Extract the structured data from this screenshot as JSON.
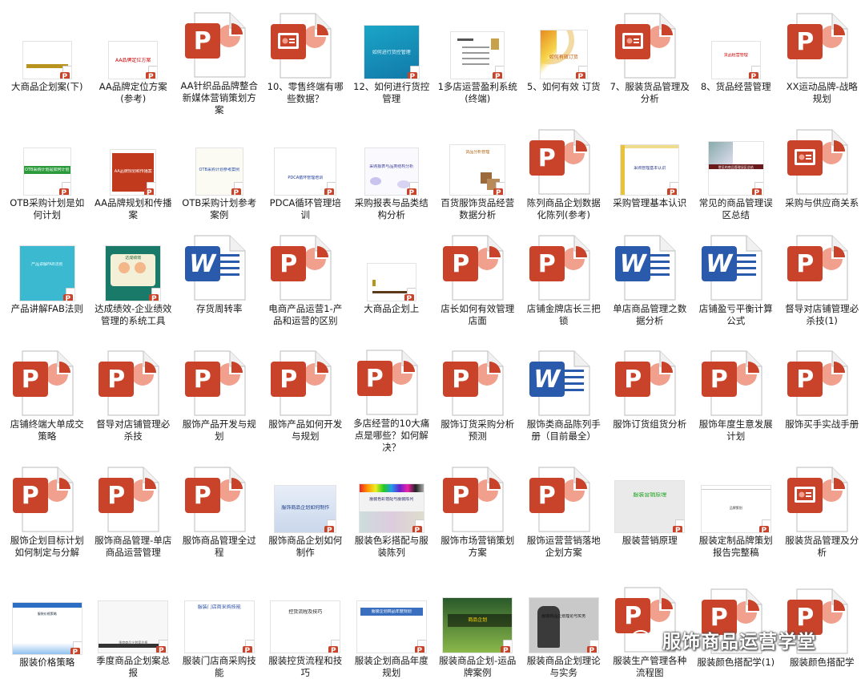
{
  "files": [
    {
      "label": "大商品企划案(下)",
      "kind": "slide",
      "style": "s_gold",
      "slide_text": ""
    },
    {
      "label": "AA品牌定位方案(参考)",
      "kind": "slide",
      "style": "s_redtitle",
      "slide_text": "AA品牌定位方案"
    },
    {
      "label": "AA针织品品牌整合新媒体营销策划方案",
      "kind": "ppt"
    },
    {
      "label": "10、零售终端有哪些数据？",
      "kind": "ppt_open"
    },
    {
      "label": "12、如何进行货控管理",
      "kind": "slide",
      "style": "s_teal",
      "slide_text": "如何进行货控管理"
    },
    {
      "label": "1多店运营盈利系统(终端)",
      "kind": "slide",
      "style": "s_list",
      "slide_text": ""
    },
    {
      "label": "5、如何有效 订货",
      "kind": "slide",
      "style": "s_swirl",
      "slide_text": "如何有效订货"
    },
    {
      "label": "7、服装货品管理及分析",
      "kind": "ppt_open"
    },
    {
      "label": "8、货品经营管理",
      "kind": "slide",
      "style": "s_redsmall",
      "slide_text": "货品经营管理"
    },
    {
      "label": "XX运动品牌-战略规划",
      "kind": "ppt"
    },
    {
      "label": "OTB采购计划是如何计划",
      "kind": "slide",
      "style": "s_greenbar",
      "slide_text": "OTB采购计划是如何计划"
    },
    {
      "label": "AA品牌规划和传播案",
      "kind": "slide",
      "style": "s_redblock",
      "slide_text": "AA品牌规划和传播案"
    },
    {
      "label": "OTB采购计划参考案例",
      "kind": "slide",
      "style": "s_bluetext",
      "slide_text": "OTB采购计划参考案例"
    },
    {
      "label": "PDCA循环管理培训",
      "kind": "slide",
      "style": "s_pdca",
      "slide_text": "PDCA循环管理培训"
    },
    {
      "label": "采购报表与品类结构分析",
      "kind": "slide",
      "style": "s_bubbles",
      "slide_text": "采购报表与品类结构分析"
    },
    {
      "label": "百货服饰货品经营数据分析",
      "kind": "slide",
      "style": "s_boxes",
      "slide_text": "货品分析管理"
    },
    {
      "label": "陈列商品企划数据化陈列(参考)",
      "kind": "ppt"
    },
    {
      "label": "采购管理基本认识",
      "kind": "slide",
      "style": "s_yellowleft",
      "slide_text": "采购管理基本认识"
    },
    {
      "label": "常见的商品管理误区总结",
      "kind": "slide",
      "style": "s_darkband",
      "slide_text": "常见的商品管理误区总结"
    },
    {
      "label": "采购与供应商关系",
      "kind": "ppt_open"
    },
    {
      "label": "产品讲解FAB法则",
      "kind": "slide",
      "style": "s_cyan",
      "slide_text": "产品讲解FAB法则"
    },
    {
      "label": "达成绩效-企业绩效管理的系统工具",
      "kind": "slide",
      "style": "s_cartoon",
      "slide_text": "达成绩效"
    },
    {
      "label": "存货周转率",
      "kind": "word"
    },
    {
      "label": "电商产品运营1-产品和运营的区别",
      "kind": "ppt"
    },
    {
      "label": "大商品企划上",
      "kind": "slide",
      "style": "s_plain",
      "slide_text": ""
    },
    {
      "label": "店长如何有效管理店面",
      "kind": "ppt"
    },
    {
      "label": "店铺金牌店长三把锁",
      "kind": "ppt"
    },
    {
      "label": "单店商品管理之数据分析",
      "kind": "word"
    },
    {
      "label": "店铺盈亏平衡计算公式",
      "kind": "word"
    },
    {
      "label": "督导对店铺管理必杀技(1)",
      "kind": "ppt"
    },
    {
      "label": "店铺终端大单成交策略",
      "kind": "ppt"
    },
    {
      "label": "督导对店铺管理必杀技",
      "kind": "ppt"
    },
    {
      "label": "服饰产品开发与规划",
      "kind": "ppt"
    },
    {
      "label": "服饰产品如何开发与规划",
      "kind": "ppt"
    },
    {
      "label": "多店经营的10大痛点是哪些？如何解决？",
      "kind": "ppt"
    },
    {
      "label": "服饰订货采购分析 预测",
      "kind": "ppt"
    },
    {
      "label": "服饰类商品陈列手册（目前最全）",
      "kind": "word"
    },
    {
      "label": "服饰订货组货分析",
      "kind": "ppt"
    },
    {
      "label": "服饰年度生意发展计划",
      "kind": "ppt"
    },
    {
      "label": "服饰买手实战手册",
      "kind": "ppt"
    },
    {
      "label": "服饰企划目标计划如何制定与分解",
      "kind": "ppt"
    },
    {
      "label": "服饰商品管理-单店商品运营管理",
      "kind": "ppt"
    },
    {
      "label": "服饰商品管理全过程",
      "kind": "ppt"
    },
    {
      "label": "服饰商品企划如何制作",
      "kind": "slide",
      "style": "s_bluegrad",
      "slide_text": "服饰商品企划如何制作"
    },
    {
      "label": "服装色彩搭配与服装陈列",
      "kind": "slide",
      "style": "s_color",
      "slide_text": "服装色彩搭配与服装陈列"
    },
    {
      "label": "服饰市场营销策划方案",
      "kind": "ppt"
    },
    {
      "label": "服饰运营营销落地企划方案",
      "kind": "ppt"
    },
    {
      "label": "服装营销原理",
      "kind": "slide",
      "style": "s_greentitle",
      "slide_text": "服装营销原理"
    },
    {
      "label": "服装定制品牌策划报告完整稿",
      "kind": "slide",
      "style": "s_minimal",
      "slide_text": "品牌策划"
    },
    {
      "label": "服装货品管理及分析",
      "kind": "ppt_open"
    },
    {
      "label": "服装价格策略",
      "kind": "slide",
      "style": "s_bluewave",
      "slide_text": "服装价格策略"
    },
    {
      "label": "季度商品企划案总报",
      "kind": "slide",
      "style": "s_greywm",
      "slide_text": "季度商品企划案总报"
    },
    {
      "label": "服装门店商采购技能",
      "kind": "slide",
      "style": "s_bluehead",
      "slide_text": "服装门店商采购技能"
    },
    {
      "label": "服装控货流程和技巧",
      "kind": "slide",
      "style": "s_blackhead",
      "slide_text": "控货流程及技巧"
    },
    {
      "label": "服装企划商品年度规划",
      "kind": "slide",
      "style": "s_bluebanner",
      "slide_text": "服装企划商品年度规划"
    },
    {
      "label": "服装商品企划-运品牌案例",
      "kind": "slide",
      "style": "s_sport",
      "slide_text": "商品企划"
    },
    {
      "label": "服装商品企划理论与实务",
      "kind": "slide",
      "style": "s_person",
      "slide_text": "服装商品企划理论与实务"
    },
    {
      "label": "服装生产管理各种流程图",
      "kind": "ppt"
    },
    {
      "label": "服装颜色搭配学(1)",
      "kind": "ppt"
    },
    {
      "label": "服装颜色搭配学",
      "kind": "ppt"
    }
  ],
  "watermark": {
    "text": "服饰商品运营学堂",
    "icon": "wechat-icon"
  },
  "colors": {
    "ppt": "#c9432a",
    "word": "#2a5aab",
    "ppt_light": "#f0a08c"
  }
}
